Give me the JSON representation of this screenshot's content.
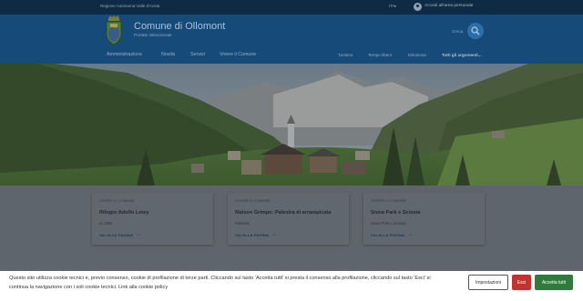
{
  "topbar": {
    "region": "Regione Autonoma Valle d'Aosta",
    "lang": "ITA",
    "login": "Accedi all'area personale"
  },
  "header": {
    "title": "Comune di Ollomont",
    "subtitle": "Portale istituzionale",
    "search_label": "Cerca"
  },
  "nav": {
    "main": [
      "Amministrazione",
      "Novità",
      "Servizi",
      "Vivere il Comune"
    ],
    "secondary": [
      "Turismo",
      "Tempo libero",
      "Istruzione",
      "Tutti gli argomenti..."
    ]
  },
  "cards": [
    {
      "category": "VIVERE IL COMUNE",
      "title": "Rifugio Adolfo Letey",
      "subtitle": "m 2465",
      "link": "VAI ALLA PAGINA"
    },
    {
      "category": "VIVERE IL COMUNE",
      "title": "Maison Grimpe: Palestra di arrampicata",
      "subtitle": "Palestra",
      "link": "VAI ALLA PAGINA"
    },
    {
      "category": "VIVERE IL COMUNE",
      "title": "Snow Park e Sciovia",
      "subtitle": "Snow Park e Sciovia",
      "link": "VAI ALLA PAGINA"
    }
  ],
  "cookie": {
    "text": "Questo sito utilizza cookie tecnici e, previo consenso, cookie di profilazione di terze parti. Cliccando sul tasto 'Accetta tutti' si presta il consenso alla profilazione, cliccando sul tasto 'Esci' si continua la navigazione con i soli cookie tecnici. Link alla cookie policy",
    "settings_label": "Impostazioni",
    "exit_label": "Esci",
    "accept_label": "Accetta tutti"
  },
  "colors": {
    "header_bg": "#164a79",
    "topbar_bg": "#0f2a45",
    "exit_button": "#c3322c",
    "accept_button": "#317a3c"
  }
}
